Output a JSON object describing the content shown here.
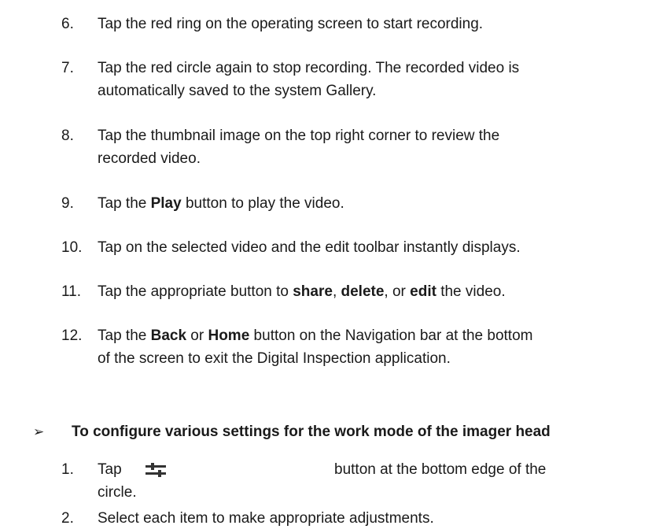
{
  "steps": [
    {
      "num": "6.",
      "text": "Tap the red ring on the operating screen to start recording."
    },
    {
      "num": "7.",
      "line1": "Tap the red circle again to stop recording. The recorded video is",
      "line2": "automatically saved to the system Gallery."
    },
    {
      "num": "8.",
      "line1": "Tap the thumbnail image on the top right corner to review the",
      "line2": "recorded video."
    },
    {
      "num": "9.",
      "pre": "Tap the ",
      "bold": "Play",
      "post": " button to play the video."
    },
    {
      "num": "10.",
      "text": "Tap on the selected video and the edit toolbar instantly displays."
    },
    {
      "num": "11.",
      "pre": "Tap the appropriate button to ",
      "b1": "share",
      "m1": ", ",
      "b2": "delete",
      "m2": ", or ",
      "b3": "edit",
      "post": " the video."
    },
    {
      "num": "12.",
      "pre": "Tap the ",
      "b1": "Back",
      "m1": " or ",
      "b2": "Home",
      "post": " button on the Navigation bar at the bottom",
      "line2": "of the screen to exit the Digital Inspection application."
    }
  ],
  "section": {
    "arrow": "➢",
    "heading": "To configure various settings for the work mode of the imager head"
  },
  "substeps": [
    {
      "num": "1.",
      "tap": "Tap",
      "icon": "settings-sliders-icon",
      "rest": "button at the bottom edge of the",
      "line2": "circle."
    },
    {
      "num": "2.",
      "text": "Select each item to make appropriate adjustments."
    }
  ]
}
